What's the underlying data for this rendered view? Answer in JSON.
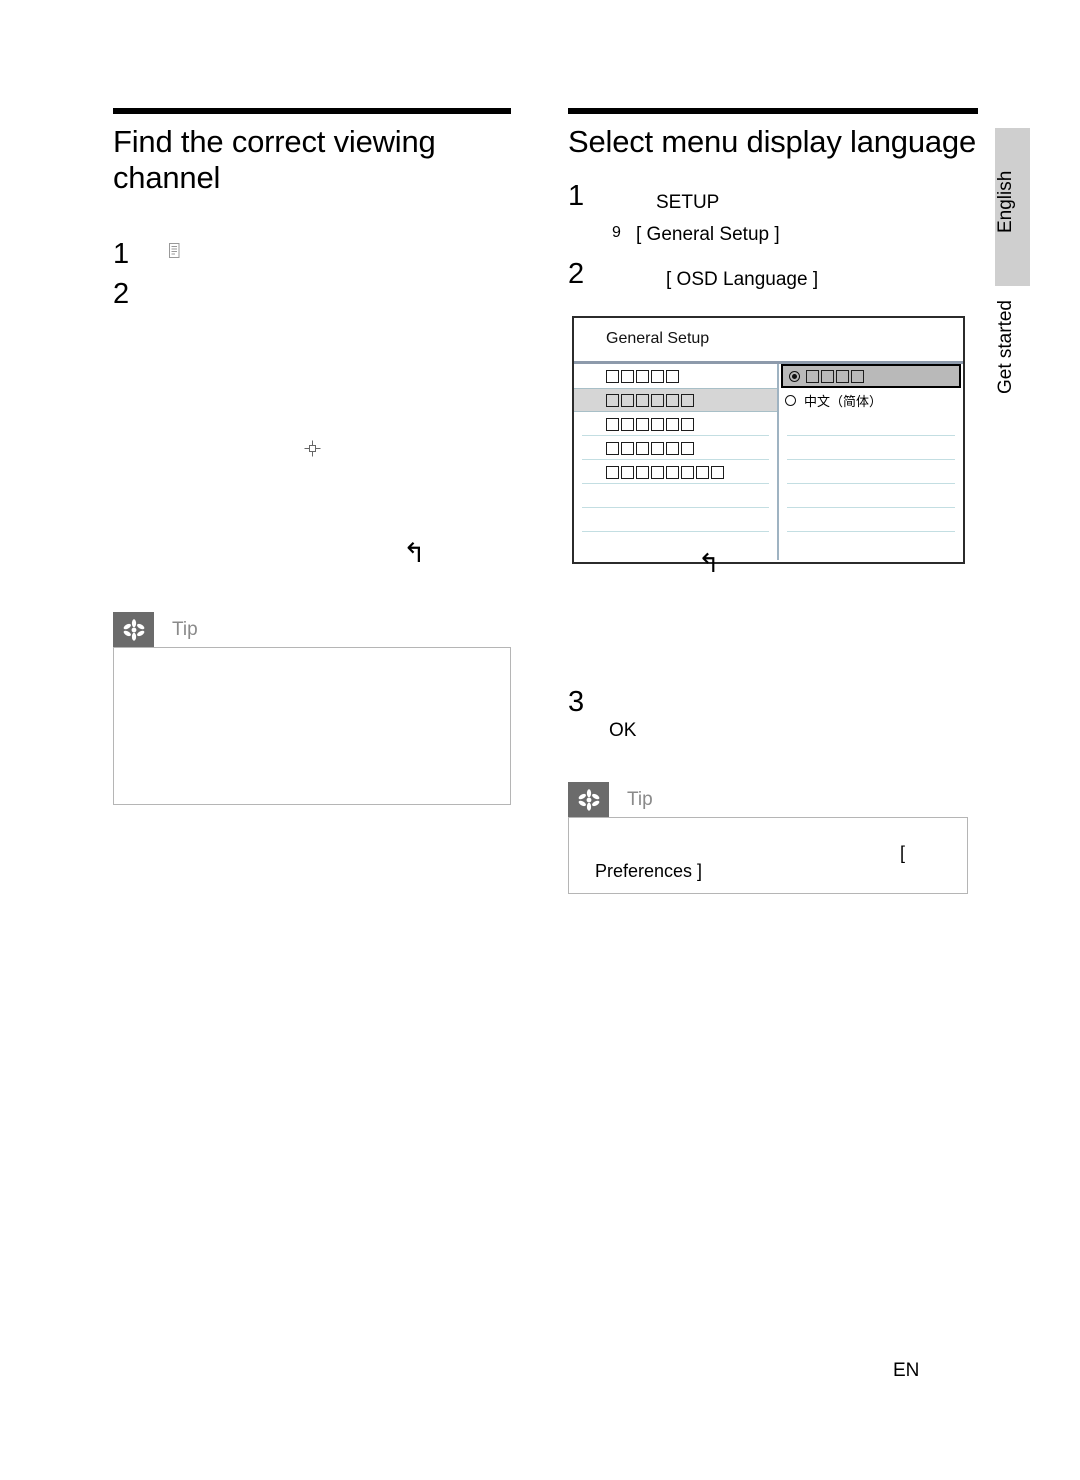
{
  "page": {
    "footer_label": "EN",
    "side_tabs": [
      {
        "name": "language-tab",
        "label": "English"
      },
      {
        "name": "chapter-tab",
        "label": "Get started"
      }
    ]
  },
  "left_column": {
    "title": "Find the correct viewing channel",
    "steps": [
      {
        "number": "1",
        "icon": "document-icon"
      },
      {
        "number": "2",
        "icon": ""
      }
    ],
    "inline_icons": {
      "navigation_icon": "navigation-crosshair-icon",
      "return_icon": "↰"
    },
    "tip": {
      "label": "Tip",
      "icon": "asterisk-icon",
      "body": ""
    }
  },
  "right_column": {
    "title": "Select menu display language",
    "steps": [
      {
        "number": "1",
        "label": "SETUP"
      },
      {
        "number": "9",
        "label": "[ General Setup ]"
      },
      {
        "number": "2",
        "label": "[ OSD Language ]"
      },
      {
        "number": "3",
        "label": "OK"
      }
    ],
    "figure": {
      "title": "General Setup",
      "return_icon": "↰",
      "left_pane_rows": [
        {
          "boxes": 5,
          "state": "normal"
        },
        {
          "boxes": 6,
          "state": "highlight"
        },
        {
          "boxes": 6,
          "state": "normal"
        },
        {
          "boxes": 6,
          "state": "normal"
        },
        {
          "boxes": 8,
          "state": "normal"
        },
        {
          "boxes": 0,
          "state": "normal"
        },
        {
          "boxes": 0,
          "state": "normal"
        }
      ],
      "right_pane_rows": [
        {
          "boxes": 4,
          "state": "selected",
          "radio": "on",
          "text": ""
        },
        {
          "boxes": 0,
          "state": "normal",
          "radio": "off",
          "text": "中文（简体）"
        },
        {
          "boxes": 0,
          "state": "normal",
          "radio": "none",
          "text": ""
        },
        {
          "boxes": 0,
          "state": "normal",
          "radio": "none",
          "text": ""
        },
        {
          "boxes": 0,
          "state": "normal",
          "radio": "none",
          "text": ""
        },
        {
          "boxes": 0,
          "state": "normal",
          "radio": "none",
          "text": ""
        },
        {
          "boxes": 0,
          "state": "normal",
          "radio": "none",
          "text": ""
        }
      ]
    },
    "tip": {
      "label": "Tip",
      "icon": "asterisk-icon",
      "stray_bracket": "[",
      "body_text": "Preferences ]"
    }
  },
  "colors": {
    "tip_icon_bg": "#6b6b6b",
    "tip_label": "#8a8a8a",
    "side_tab_bg": "#cfcfcf",
    "figure_border": "#2b2b2b",
    "figure_divider": "#8d9aab",
    "figure_row_sep": "#c3dee2",
    "highlight_row": "#d6d6d6",
    "selected_row": "#b9b9b9"
  }
}
